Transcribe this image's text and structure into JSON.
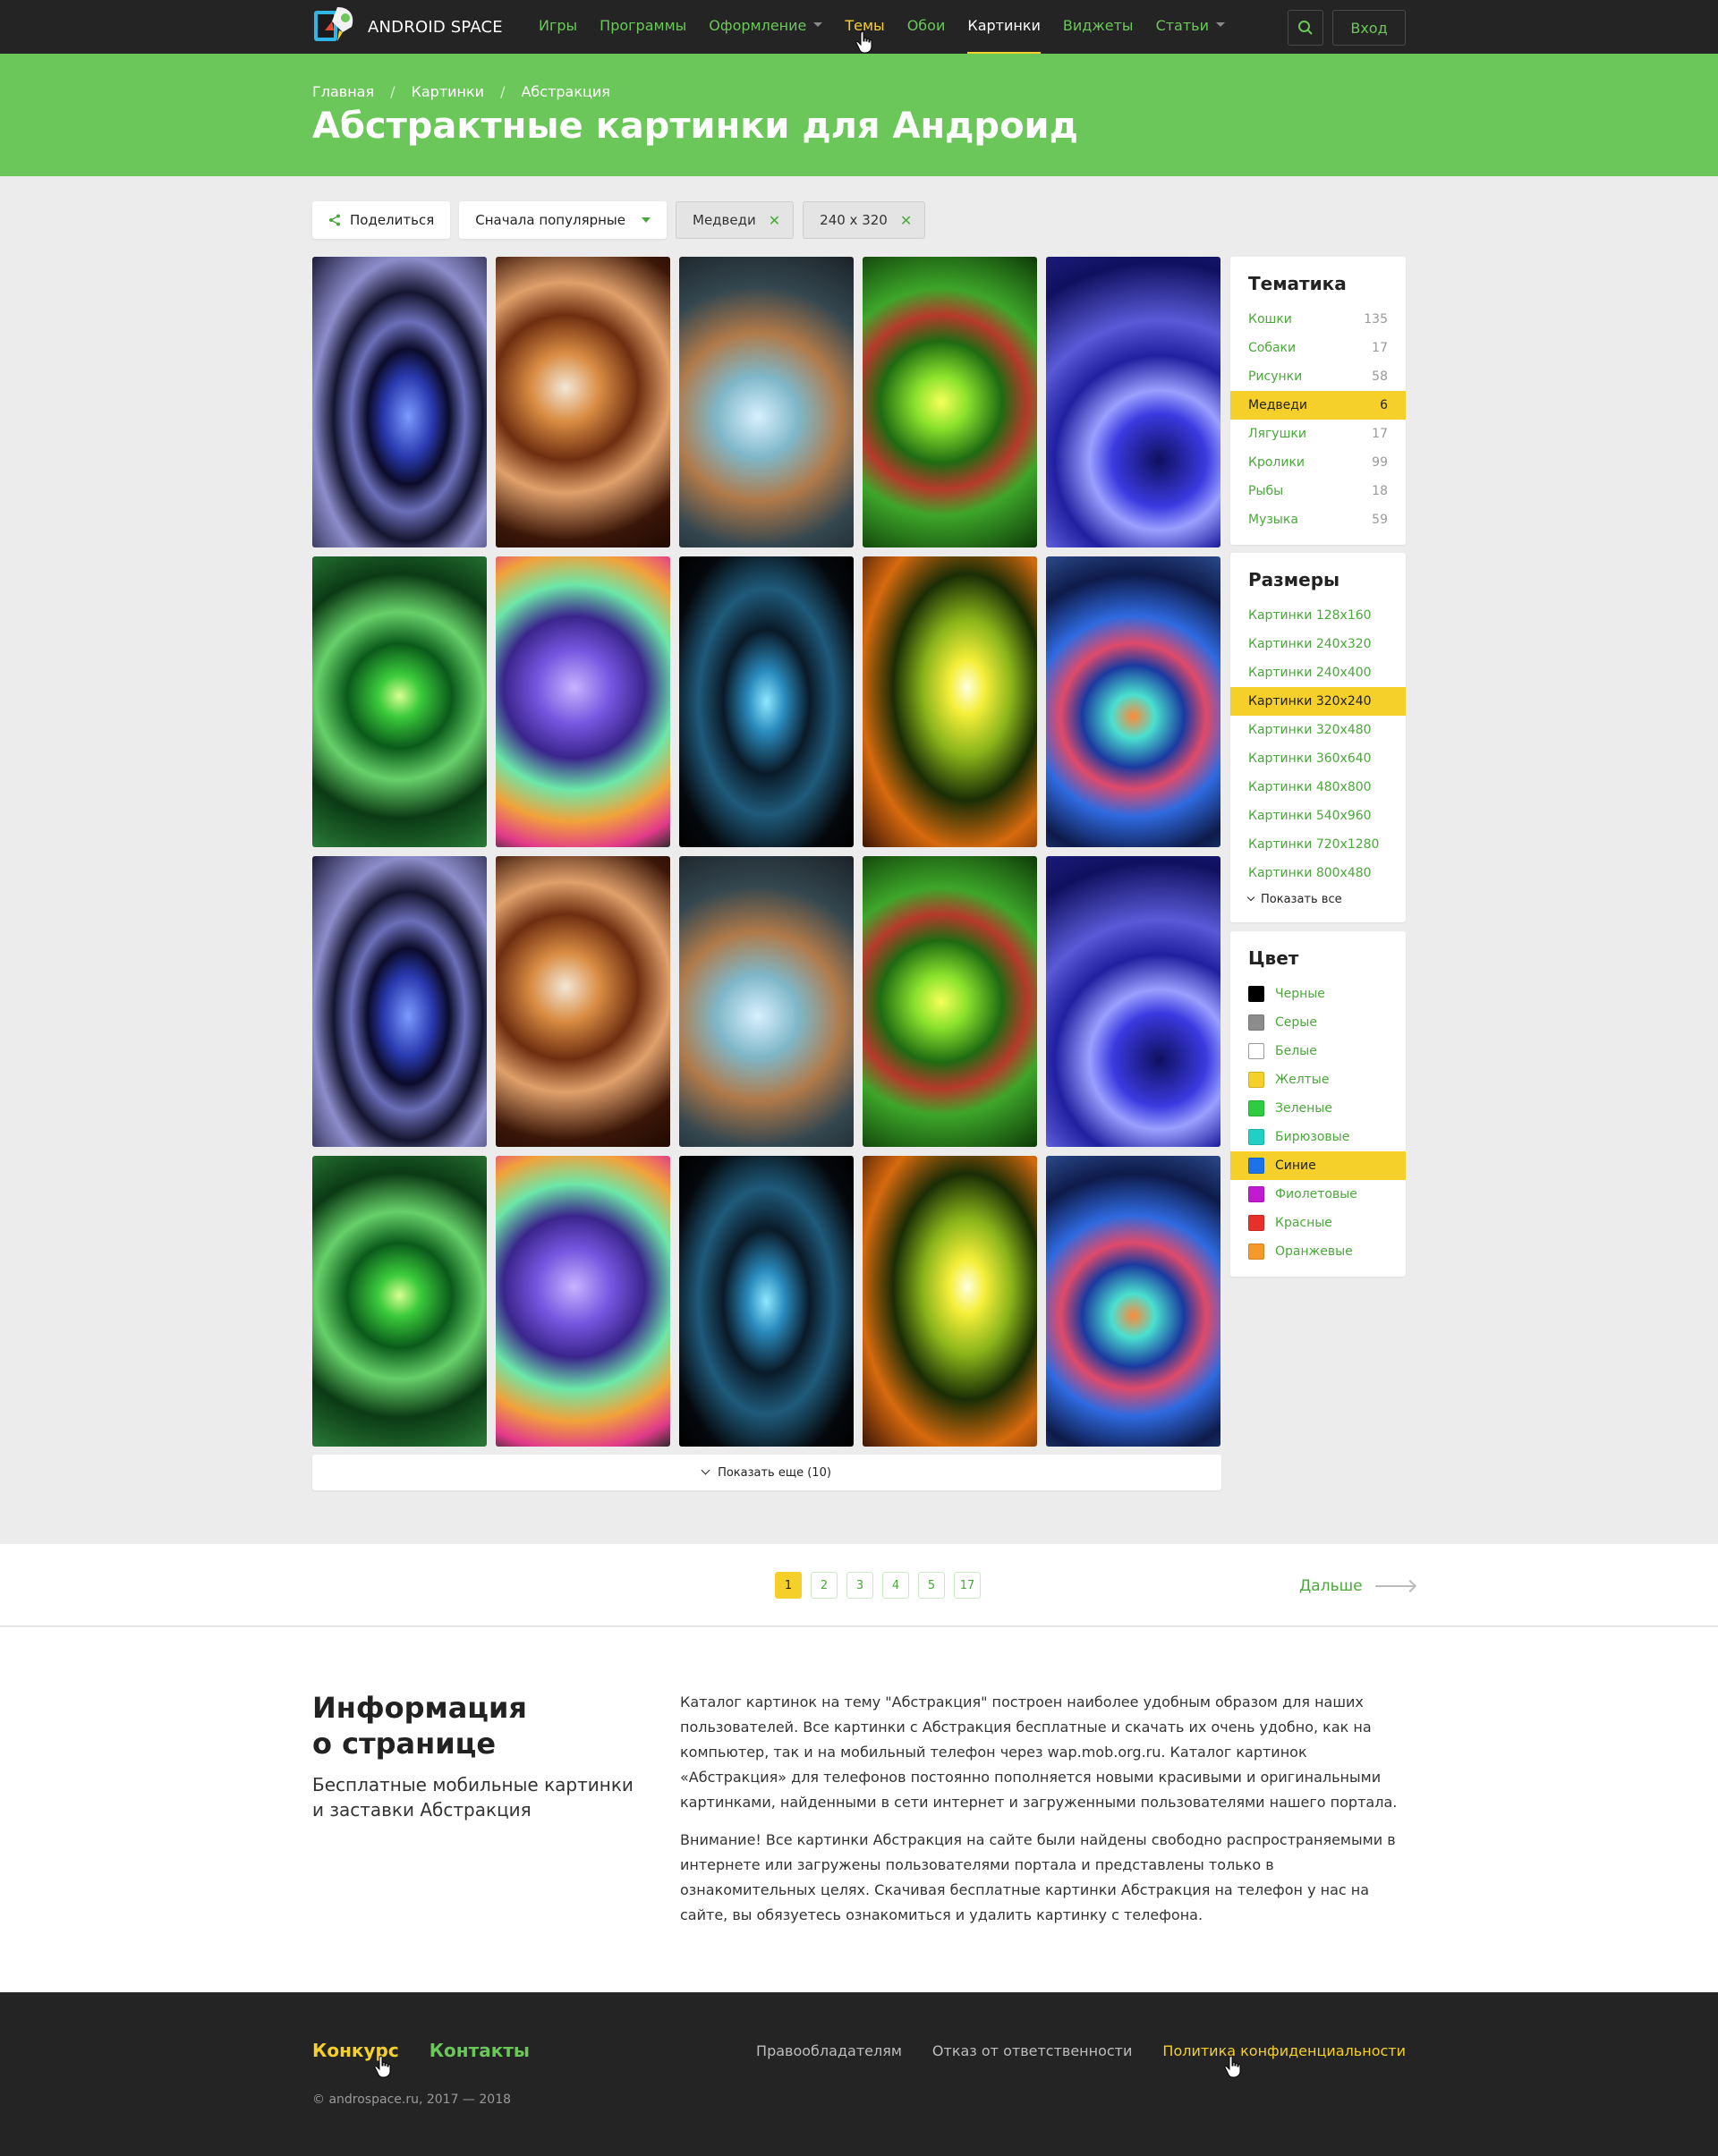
{
  "header": {
    "logo_text": "ANDROID SPACE",
    "nav": [
      {
        "label": "Игры",
        "state": "normal",
        "dropdown": false
      },
      {
        "label": "Программы",
        "state": "normal",
        "dropdown": false
      },
      {
        "label": "Оформление",
        "state": "normal",
        "dropdown": true
      },
      {
        "label": "Темы",
        "state": "hover",
        "dropdown": false
      },
      {
        "label": "Обои",
        "state": "normal",
        "dropdown": false
      },
      {
        "label": "Картинки",
        "state": "active",
        "dropdown": false
      },
      {
        "label": "Виджеты",
        "state": "normal",
        "dropdown": false
      },
      {
        "label": "Статьи",
        "state": "normal",
        "dropdown": true
      }
    ],
    "login_label": "Вход"
  },
  "hero": {
    "breadcrumbs": [
      "Главная",
      "Картинки",
      "Абстракция"
    ],
    "title": "Абстрактные картинки для Андроид"
  },
  "filters": {
    "share_label": "Поделиться",
    "sort_label": "Сначала популярные",
    "chips": [
      "Медведи",
      "240 x 320"
    ]
  },
  "gallery": {
    "tiles": [
      "t0",
      "t1",
      "t2",
      "t3",
      "t4",
      "t5",
      "t6",
      "t7",
      "t8",
      "t9",
      "t0",
      "t1",
      "t2",
      "t3",
      "t4",
      "t5",
      "t6",
      "t7",
      "t8",
      "t9"
    ],
    "show_more_label": "Показать еще (10)"
  },
  "sidebar": {
    "topics": {
      "title": "Тематика",
      "items": [
        {
          "label": "Кошки",
          "count": "135",
          "selected": false
        },
        {
          "label": "Собаки",
          "count": "17",
          "selected": false
        },
        {
          "label": "Рисунки",
          "count": "58",
          "selected": false
        },
        {
          "label": "Медведи",
          "count": "6",
          "selected": true
        },
        {
          "label": "Лягушки",
          "count": "17",
          "selected": false
        },
        {
          "label": "Кролики",
          "count": "99",
          "selected": false
        },
        {
          "label": "Рыбы",
          "count": "18",
          "selected": false
        },
        {
          "label": "Музыка",
          "count": "59",
          "selected": false
        }
      ]
    },
    "sizes": {
      "title": "Размеры",
      "items": [
        {
          "label": "Картинки 128x160",
          "selected": false
        },
        {
          "label": "Картинки 240x320",
          "selected": false
        },
        {
          "label": "Картинки 240x400",
          "selected": false
        },
        {
          "label": "Картинки 320x240",
          "selected": true
        },
        {
          "label": "Картинки 320x480",
          "selected": false
        },
        {
          "label": "Картинки 360x640",
          "selected": false
        },
        {
          "label": "Картинки 480x800",
          "selected": false
        },
        {
          "label": "Картинки 540x960",
          "selected": false
        },
        {
          "label": "Картинки 720x1280",
          "selected": false
        },
        {
          "label": "Картинки 800x480",
          "selected": false
        }
      ],
      "show_all_label": "Показать все"
    },
    "colors": {
      "title": "Цвет",
      "items": [
        {
          "label": "Черные",
          "color": "#000000",
          "selected": false
        },
        {
          "label": "Серые",
          "color": "#8c8c8c",
          "selected": false
        },
        {
          "label": "Белые",
          "color": "#ffffff",
          "selected": false
        },
        {
          "label": "Желтые",
          "color": "#f5d02a",
          "selected": false
        },
        {
          "label": "Зеленые",
          "color": "#2ecc40",
          "selected": false
        },
        {
          "label": "Бирюзовые",
          "color": "#22cfc4",
          "selected": false
        },
        {
          "label": "Синие",
          "color": "#1a73e8",
          "selected": true
        },
        {
          "label": "Фиолетовые",
          "color": "#c21ad1",
          "selected": false
        },
        {
          "label": "Красные",
          "color": "#e8302a",
          "selected": false
        },
        {
          "label": "Оранжевые",
          "color": "#f59a2a",
          "selected": false
        }
      ]
    }
  },
  "pagination": {
    "pages": [
      "1",
      "2",
      "3",
      "4",
      "5",
      "17"
    ],
    "current": "1",
    "next_label": "Дальше"
  },
  "info": {
    "title_line1": "Информация",
    "title_line2": "о странице",
    "subtitle": "Бесплатные мобильные картинки и заставки Абстракция",
    "paragraph1": "Каталог картинок на тему \"Абстракция\" построен наиболее удобным образом для наших пользователей. Все картинки с Абстракция бесплатные и скачать их очень удобно, как на компьютер, так и на мобильный телефон через wap.mob.org.ru. Каталог картинок «Абстракция» для телефонов постоянно пополняется новыми красивыми и оригинальными картинками, найденными в сети интернет и загруженными пользователями нашего портала.",
    "paragraph2": "Внимание! Все картинки Абстракция на сайте были найдены свободно распространяемыми в интернете или загружены пользователями портала и представлены только в ознакомительных целях. Скачивая бесплатные картинки Абстракция на телефон у нас на сайте, вы обязуетесь ознакомиться и удалить картинку с телефона."
  },
  "footer": {
    "left_links": [
      {
        "label": "Конкурс",
        "accent": "#f5d02a"
      },
      {
        "label": "Контакты",
        "accent": "#6cc75a"
      }
    ],
    "right_links": [
      {
        "label": "Правообладателям",
        "highlight": false
      },
      {
        "label": "Отказ от ответственности",
        "highlight": false
      },
      {
        "label": "Политика конфиденциальности",
        "highlight": true
      }
    ],
    "copyright": "© androspace.ru, 2017 — 2018"
  },
  "colors": {
    "brand_green": "#6cc75a",
    "accent_yellow": "#f5d02a",
    "dark": "#242424"
  }
}
